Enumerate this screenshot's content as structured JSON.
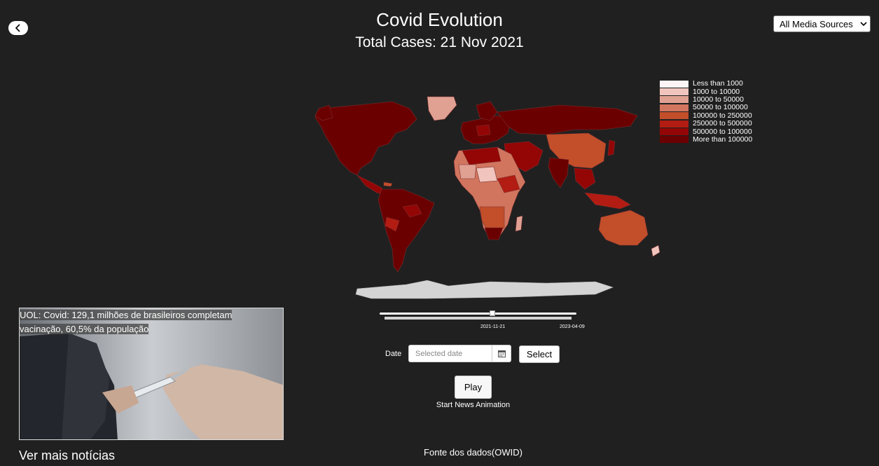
{
  "header": {
    "title": "Covid Evolution",
    "subtitle": "Total Cases: 21 Nov 2021"
  },
  "media_select": {
    "value": "All Media Sources"
  },
  "legend": {
    "items": [
      {
        "label": "Less than 1000",
        "color": "#fdf5f5"
      },
      {
        "label": "1000 to 10000",
        "color": "#f1c5bd"
      },
      {
        "label": "10000 to 50000",
        "color": "#e0a193"
      },
      {
        "label": "50000 to 100000",
        "color": "#d2755f"
      },
      {
        "label": "100000 to 250000",
        "color": "#c24e2a"
      },
      {
        "label": "250000 to 500000",
        "color": "#b31c12"
      },
      {
        "label": "500000 to 100000",
        "color": "#940606"
      },
      {
        "label": "More than 100000",
        "color": "#6b0000"
      }
    ]
  },
  "slider": {
    "value": "2021-11-21",
    "end_label": "2023-04-09"
  },
  "date_picker": {
    "label": "Date",
    "placeholder": "Selected date"
  },
  "buttons": {
    "select": "Select",
    "play": "Play",
    "play_caption": "Start News Animation"
  },
  "news": {
    "headline": "UOL: Covid: 129,1 milhões de brasileiros completam vacinação, 60,5% da população",
    "more": "Ver mais notícias"
  },
  "footer": {
    "source": "Fonte dos dados(OWID)"
  },
  "icons": {
    "back": "chevron-left-icon",
    "calendar": "calendar-icon",
    "dropdown": "chevron-down-icon"
  }
}
